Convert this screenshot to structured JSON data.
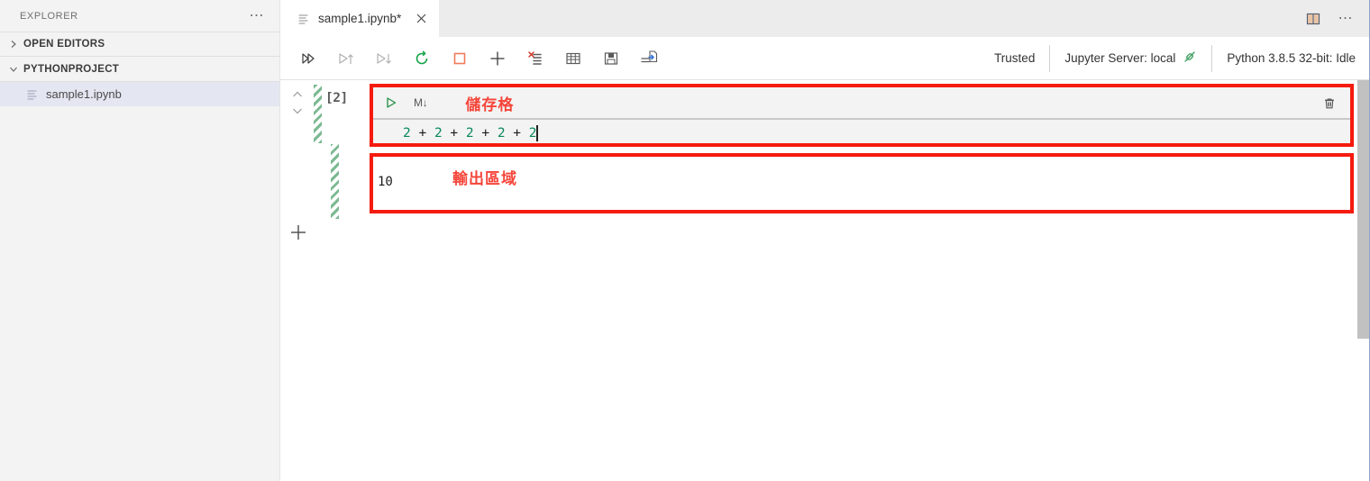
{
  "sidebar": {
    "title": "EXPLORER",
    "more_icon": "ellipsis-icon",
    "sections": [
      {
        "label": "OPEN EDITORS",
        "expanded": false,
        "chevron": "chevron-right-icon"
      },
      {
        "label": "PYTHONPROJECT",
        "expanded": true,
        "chevron": "chevron-down-icon"
      }
    ],
    "files": [
      {
        "name": "sample1.ipynb",
        "selected": true,
        "icon": "notebook-file-icon"
      }
    ]
  },
  "tabbar": {
    "tabs": [
      {
        "label": "sample1.ipynb*",
        "icon": "notebook-file-icon",
        "active": true,
        "close_icon": "close-icon"
      }
    ],
    "split_editor_icon": "split-editor-icon",
    "more_icon": "ellipsis-icon"
  },
  "toolbar": {
    "buttons": [
      {
        "name": "run-all-button",
        "icon": "double-play-icon",
        "title": "Run All"
      },
      {
        "name": "run-above-button",
        "icon": "play-up-icon",
        "title": "Run Above"
      },
      {
        "name": "run-below-button",
        "icon": "play-down-icon",
        "title": "Run Below"
      },
      {
        "name": "restart-kernel-button",
        "icon": "restart-icon",
        "title": "Restart"
      },
      {
        "name": "interrupt-kernel-button",
        "icon": "stop-square-icon",
        "title": "Interrupt"
      },
      {
        "name": "add-cell-button",
        "icon": "plus-icon",
        "title": "Add Cell"
      },
      {
        "name": "clear-outputs-button",
        "icon": "clear-outputs-icon",
        "title": "Clear All Outputs"
      },
      {
        "name": "variables-button",
        "icon": "table-grid-icon",
        "title": "Variables"
      },
      {
        "name": "save-button",
        "icon": "floppy-save-icon",
        "title": "Save"
      },
      {
        "name": "export-button",
        "icon": "export-icon",
        "title": "Export"
      }
    ],
    "status": {
      "trusted": "Trusted",
      "server": "Jupyter Server: local",
      "server_icon": "connected-plug-icon",
      "kernel": "Python 3.8.5 32-bit: Idle"
    }
  },
  "notebook": {
    "move_up_icon": "chevron-up-icon",
    "move_down_icon": "chevron-down-icon",
    "execution_count": "[2]",
    "cell": {
      "run_icon": "play-triangle-icon",
      "language_badge": "M↓",
      "delete_icon": "trash-icon",
      "annotation": "儲存格",
      "code_tokens": [
        {
          "t": "2",
          "k": "num"
        },
        {
          "t": " + ",
          "k": "op"
        },
        {
          "t": "2",
          "k": "num"
        },
        {
          "t": " + ",
          "k": "op"
        },
        {
          "t": "2",
          "k": "num"
        },
        {
          "t": " + ",
          "k": "op"
        },
        {
          "t": "2",
          "k": "num"
        },
        {
          "t": " + ",
          "k": "op"
        },
        {
          "t": "2",
          "k": "num"
        }
      ],
      "code_text": "2 + 2 + 2 + 2 + 2"
    },
    "output": {
      "value": "10",
      "annotation": "輸出區域"
    },
    "add_cell_below_icon": "plus-icon"
  },
  "colors": {
    "annotation_red": "#f51b0e",
    "code_green": "#09885a",
    "hatch_green": "#7cb992",
    "selection_blue": "#e4e6f1",
    "scrollbar_gray": "#c1c1c1"
  }
}
